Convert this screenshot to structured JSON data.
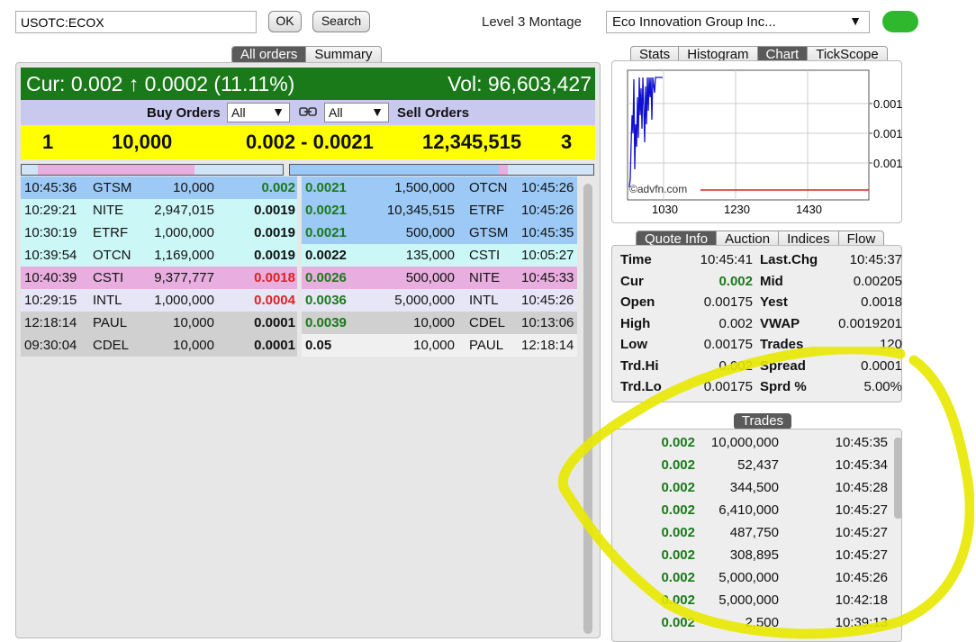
{
  "toolbar": {
    "symbol_value": "USOTC:ECOX",
    "ok_label": "OK",
    "search_label": "Search",
    "montage_label": "Level 3 Montage",
    "company": "Eco Innovation Group Inc...",
    "company_arrow": "▼"
  },
  "order_tabs": [
    "All orders",
    "Summary"
  ],
  "quote_bar": {
    "cur_text": "Cur: 0.002 ↑ 0.0002 (11.11%)",
    "vol_text": "Vol: 96,603,427"
  },
  "filter": {
    "buy_label": "Buy Orders",
    "sell_label": "Sell Orders",
    "buy_filter": "All",
    "sell_filter": "All",
    "arrow": "▼"
  },
  "summary": {
    "bid_count": "1",
    "bid_size": "10,000",
    "spread": "0.002 - 0.0021",
    "ask_size": "12,345,515",
    "ask_count": "3"
  },
  "buy_orders": [
    {
      "time": "10:45:36",
      "mm": "GTSM",
      "size": "10,000",
      "price": "0.002",
      "price_style": "green",
      "bg": "#9cc9f5"
    },
    {
      "time": "10:29:21",
      "mm": "NITE",
      "size": "2,947,015",
      "price": "0.0019",
      "price_style": "bold",
      "bg": "#ccf7f7"
    },
    {
      "time": "10:30:19",
      "mm": "ETRF",
      "size": "1,000,000",
      "price": "0.0019",
      "price_style": "bold",
      "bg": "#ccf7f7"
    },
    {
      "time": "10:39:54",
      "mm": "OTCN",
      "size": "1,169,000",
      "price": "0.0019",
      "price_style": "bold",
      "bg": "#ccf7f7"
    },
    {
      "time": "10:40:39",
      "mm": "CSTI",
      "size": "9,377,777",
      "price": "0.0018",
      "price_style": "red",
      "bg": "#e9aee0"
    },
    {
      "time": "10:29:15",
      "mm": "INTL",
      "size": "1,000,000",
      "price": "0.0004",
      "price_style": "red",
      "bg": "#e6e6f7"
    },
    {
      "time": "12:18:14",
      "mm": "PAUL",
      "size": "10,000",
      "price": "0.0001",
      "price_style": "bold",
      "bg": "#d0d0d0"
    },
    {
      "time": "09:30:04",
      "mm": "CDEL",
      "size": "10,000",
      "price": "0.0001",
      "price_style": "bold",
      "bg": "#d0d0d0"
    }
  ],
  "sell_orders": [
    {
      "price": "0.0021",
      "price_style": "green",
      "size": "1,500,000",
      "mm": "OTCN",
      "time": "10:45:26",
      "bg": "#9cc9f5"
    },
    {
      "price": "0.0021",
      "price_style": "green",
      "size": "10,345,515",
      "mm": "ETRF",
      "time": "10:45:26",
      "bg": "#9cc9f5"
    },
    {
      "price": "0.0021",
      "price_style": "green",
      "size": "500,000",
      "mm": "GTSM",
      "time": "10:45:35",
      "bg": "#9cc9f5"
    },
    {
      "price": "0.0022",
      "price_style": "bold",
      "size": "135,000",
      "mm": "CSTI",
      "time": "10:05:27",
      "bg": "#ccf7f7"
    },
    {
      "price": "0.0026",
      "price_style": "green",
      "size": "500,000",
      "mm": "NITE",
      "time": "10:45:33",
      "bg": "#e9aee0"
    },
    {
      "price": "0.0036",
      "price_style": "green",
      "size": "5,000,000",
      "mm": "INTL",
      "time": "10:45:26",
      "bg": "#e6e6f7"
    },
    {
      "price": "0.0039",
      "price_style": "green",
      "size": "10,000",
      "mm": "CDEL",
      "time": "10:13:06",
      "bg": "#d0d0d0"
    },
    {
      "price": "0.05",
      "price_style": "bold",
      "size": "10,000",
      "mm": "PAUL",
      "time": "12:18:14",
      "bg": "#f0f0f0"
    }
  ],
  "chart_tabs": [
    "Stats",
    "Histogram",
    "Chart",
    "TickScope"
  ],
  "chart": {
    "watermark": "©advfn.com",
    "x_ticks": [
      "1030",
      "1230",
      "1430"
    ],
    "y_ticks": [
      "0.001",
      "0.001",
      "0.001"
    ]
  },
  "info_tabs": [
    "Quote Info",
    "Auction",
    "Indices",
    "Flow"
  ],
  "quote_info": [
    {
      "l1": "Time",
      "v1": "10:45:41",
      "v1_style": "",
      "l2": "Last.Chg",
      "v2": "10:45:37"
    },
    {
      "l1": "Cur",
      "v1": "0.002",
      "v1_style": "green",
      "l2": "Mid",
      "v2": "0.00205"
    },
    {
      "l1": "Open",
      "v1": "0.00175",
      "v1_style": "",
      "l2": "Yest",
      "v2": "0.0018"
    },
    {
      "l1": "High",
      "v1": "0.002",
      "v1_style": "",
      "l2": "VWAP",
      "v2": "0.0019201"
    },
    {
      "l1": "Low",
      "v1": "0.00175",
      "v1_style": "",
      "l2": "Trades",
      "v2": "120"
    },
    {
      "l1": "Trd.Hi",
      "v1": "0.002",
      "v1_style": "",
      "l2": "Spread",
      "v2": "0.0001"
    },
    {
      "l1": "Trd.Lo",
      "v1": "0.00175",
      "v1_style": "",
      "l2": "Sprd %",
      "v2": "5.00%"
    }
  ],
  "trades_label": "Trades",
  "trades": [
    {
      "price": "0.002",
      "size": "10,000,000",
      "time": "10:45:35"
    },
    {
      "price": "0.002",
      "size": "52,437",
      "time": "10:45:34"
    },
    {
      "price": "0.002",
      "size": "344,500",
      "time": "10:45:28"
    },
    {
      "price": "0.002",
      "size": "6,410,000",
      "time": "10:45:27"
    },
    {
      "price": "0.002",
      "size": "487,750",
      "time": "10:45:27"
    },
    {
      "price": "0.002",
      "size": "308,895",
      "time": "10:45:27"
    },
    {
      "price": "0.002",
      "size": "5,000,000",
      "time": "10:45:26"
    },
    {
      "price": "0.002",
      "size": "5,000,000",
      "time": "10:42:18"
    },
    {
      "price": "0.002",
      "size": "2,500",
      "time": "10:39:13"
    }
  ],
  "colors": {
    "accent_green": "#1a7a1a",
    "highlight_yellow": "#e8e800"
  }
}
